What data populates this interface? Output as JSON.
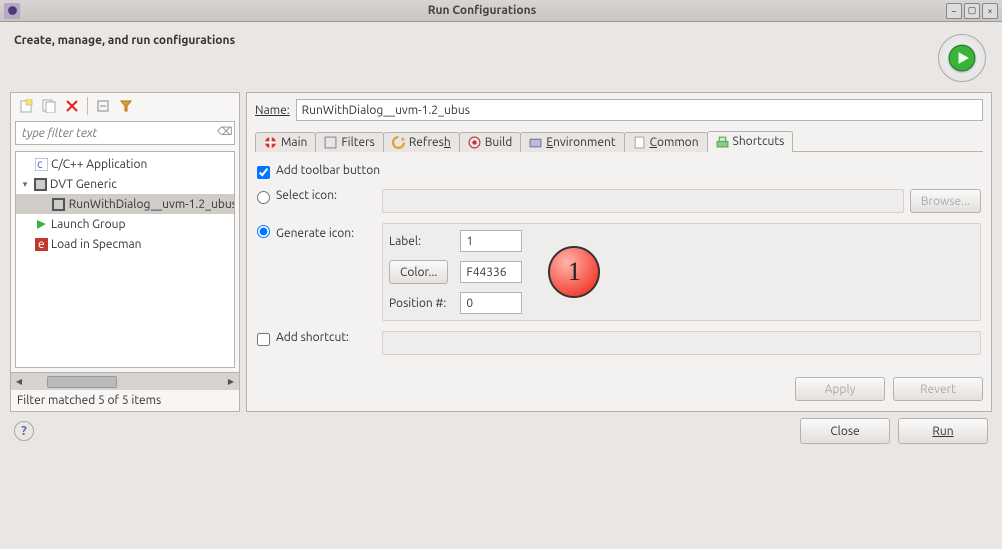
{
  "window": {
    "title": "Run Configurations"
  },
  "header": {
    "title": "Create, manage, and run configurations"
  },
  "filter": {
    "placeholder": "type filter text"
  },
  "tree": {
    "items": [
      {
        "label": "C/C++ Application"
      },
      {
        "label": "DVT Generic",
        "expanded": true,
        "children": [
          {
            "label": "RunWithDialog__uvm-1.2_ubus",
            "selected": true
          }
        ]
      },
      {
        "label": "Launch Group"
      },
      {
        "label": "Load in Specman"
      }
    ],
    "status": "Filter matched 5 of 5 items"
  },
  "name": {
    "label": "Name:",
    "value": "RunWithDialog__uvm-1.2_ubus"
  },
  "tabs": [
    "Main",
    "Filters",
    "Refresh",
    "Build",
    "Environment",
    "Common",
    "Shortcuts"
  ],
  "activeTab": "Shortcuts",
  "shortcuts": {
    "addToolbar": {
      "label": "Add toolbar button",
      "checked": true
    },
    "selectIcon": {
      "label": "Select icon:",
      "browse": "Browse..."
    },
    "generateIcon": {
      "label": "Generate icon:",
      "labelField": {
        "label": "Label:",
        "value": "1"
      },
      "colorBtn": "Color...",
      "colorValue": "F44336",
      "position": {
        "label": "Position #:",
        "value": "0"
      },
      "previewText": "1"
    },
    "addShortcut": {
      "label": "Add shortcut:",
      "checked": false
    }
  },
  "buttons": {
    "apply": "Apply",
    "revert": "Revert",
    "close": "Close",
    "run": "Run"
  },
  "chart_data": {
    "type": "table",
    "title": "",
    "columns": [],
    "rows": []
  }
}
